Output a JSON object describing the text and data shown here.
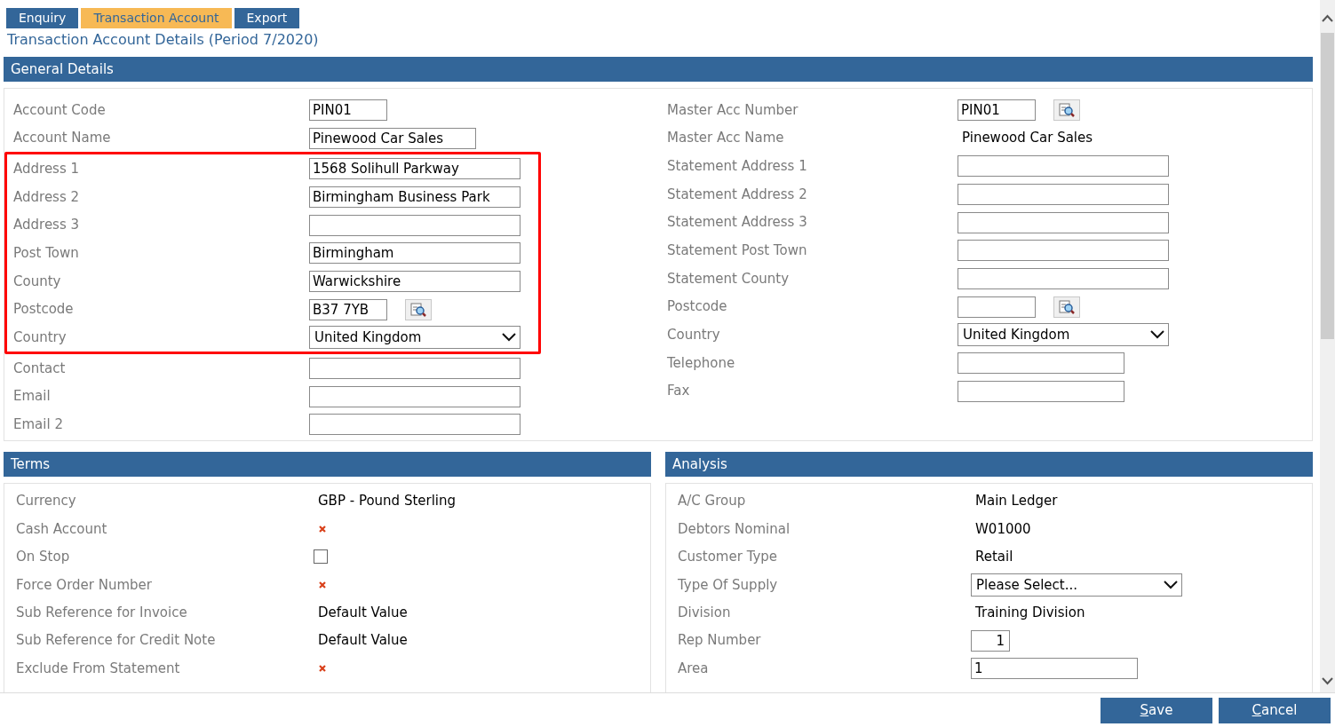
{
  "tabs": [
    {
      "label": "Enquiry",
      "selected": false
    },
    {
      "label": "Transaction Account",
      "selected": true
    },
    {
      "label": "Export",
      "selected": false
    }
  ],
  "page_title": "Transaction Account Details (Period 7/2020)",
  "general": {
    "title": "General Details",
    "left_groups": [
      {
        "highlighted": false,
        "rows": [
          {
            "label": "Account Code",
            "kind": "short",
            "value": "PIN01"
          },
          {
            "label": "Account Name",
            "kind": "medium",
            "value": "Pinewood Car Sales"
          }
        ]
      },
      {
        "highlighted": true,
        "rows": [
          {
            "label": "Address 1",
            "kind": "input",
            "value": "1568 Solihull Parkway"
          },
          {
            "label": "Address 2",
            "kind": "input",
            "value": "Birmingham Business Park"
          },
          {
            "label": "Address 3",
            "kind": "input"
          },
          {
            "label": "Post Town",
            "kind": "input",
            "value": "Birmingham"
          },
          {
            "label": "County",
            "kind": "input",
            "value": "Warwickshire"
          },
          {
            "label": "Postcode",
            "kind": "lookup",
            "value": "B37 7YB"
          },
          {
            "label": "Country",
            "kind": "select",
            "value": "United Kingdom"
          }
        ]
      },
      {
        "highlighted": false,
        "rows": [
          {
            "label": "Contact",
            "kind": "input"
          },
          {
            "label": "Email",
            "kind": "input"
          },
          {
            "label": "Email 2",
            "kind": "input"
          }
        ]
      }
    ],
    "right_rows": [
      {
        "label": "Master Acc Number",
        "kind": "lookup",
        "value": "PIN01"
      },
      {
        "label": "Master Acc Name",
        "kind": "text",
        "value": "Pinewood Car Sales"
      },
      {
        "label": "Statement Address 1",
        "kind": "input"
      },
      {
        "label": "Statement Address 2",
        "kind": "input"
      },
      {
        "label": "Statement Address 3",
        "kind": "input"
      },
      {
        "label": "Statement Post Town",
        "kind": "input"
      },
      {
        "label": "Statement County",
        "kind": "input"
      },
      {
        "label": "Postcode",
        "kind": "lookup"
      },
      {
        "label": "Country",
        "kind": "select",
        "value": "United Kingdom"
      },
      {
        "label": "Telephone",
        "kind": "medium"
      },
      {
        "label": "Fax",
        "kind": "medium"
      }
    ]
  },
  "terms": {
    "title": "Terms",
    "rows": [
      {
        "label": "Currency",
        "kind": "text",
        "value": "GBP - Pound Sterling"
      },
      {
        "label": "Cash Account",
        "kind": "cross"
      },
      {
        "label": "On Stop",
        "kind": "checkbox",
        "checked": false
      },
      {
        "label": "Force Order Number",
        "kind": "cross"
      },
      {
        "label": "Sub Reference for Invoice",
        "kind": "text",
        "value": "Default Value"
      },
      {
        "label": "Sub Reference for Credit Note",
        "kind": "text",
        "value": "Default Value"
      },
      {
        "label": "Exclude From Statement",
        "kind": "cross"
      }
    ]
  },
  "analysis": {
    "title": "Analysis",
    "rows": [
      {
        "label": "A/C Group",
        "kind": "text",
        "value": "Main Ledger"
      },
      {
        "label": "Debtors Nominal",
        "kind": "text",
        "value": "W01000"
      },
      {
        "label": "Customer Type",
        "kind": "text",
        "value": "Retail"
      },
      {
        "label": "Type Of Supply",
        "kind": "wideselect",
        "value": "Please Select..."
      },
      {
        "label": "Division",
        "kind": "text",
        "value": "Training Division"
      },
      {
        "label": "Rep Number",
        "kind": "number",
        "value": "1"
      },
      {
        "label": "Area",
        "kind": "medium",
        "value": "1"
      }
    ]
  },
  "buttons": [
    {
      "label": "Save"
    },
    {
      "label": "Cancel"
    }
  ]
}
